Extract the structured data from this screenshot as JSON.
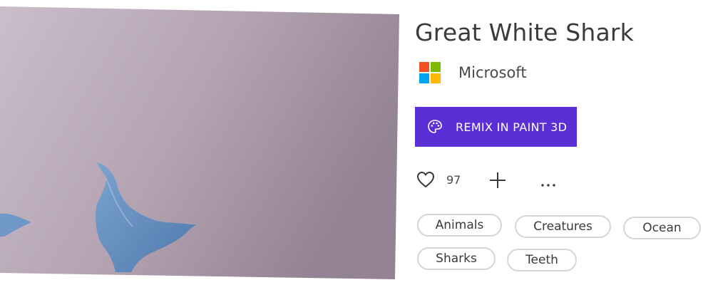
{
  "model": {
    "title": "Great White Shark",
    "preview_background": "#b8a7b4"
  },
  "publisher": {
    "name": "Microsoft",
    "logo_colors": [
      "#f25022",
      "#7fba00",
      "#00a4ef",
      "#ffb900"
    ]
  },
  "remix": {
    "label": "REMIX IN PAINT 3D",
    "icon": "palette-icon",
    "color": "#5b2fd6"
  },
  "actions": {
    "like_icon": "heart-icon",
    "like_count": "97",
    "add_icon": "plus-icon",
    "more_icon": "ellipsis-icon"
  },
  "tags": [
    "Animals",
    "Creatures",
    "Ocean",
    "Sharks",
    "Teeth"
  ]
}
